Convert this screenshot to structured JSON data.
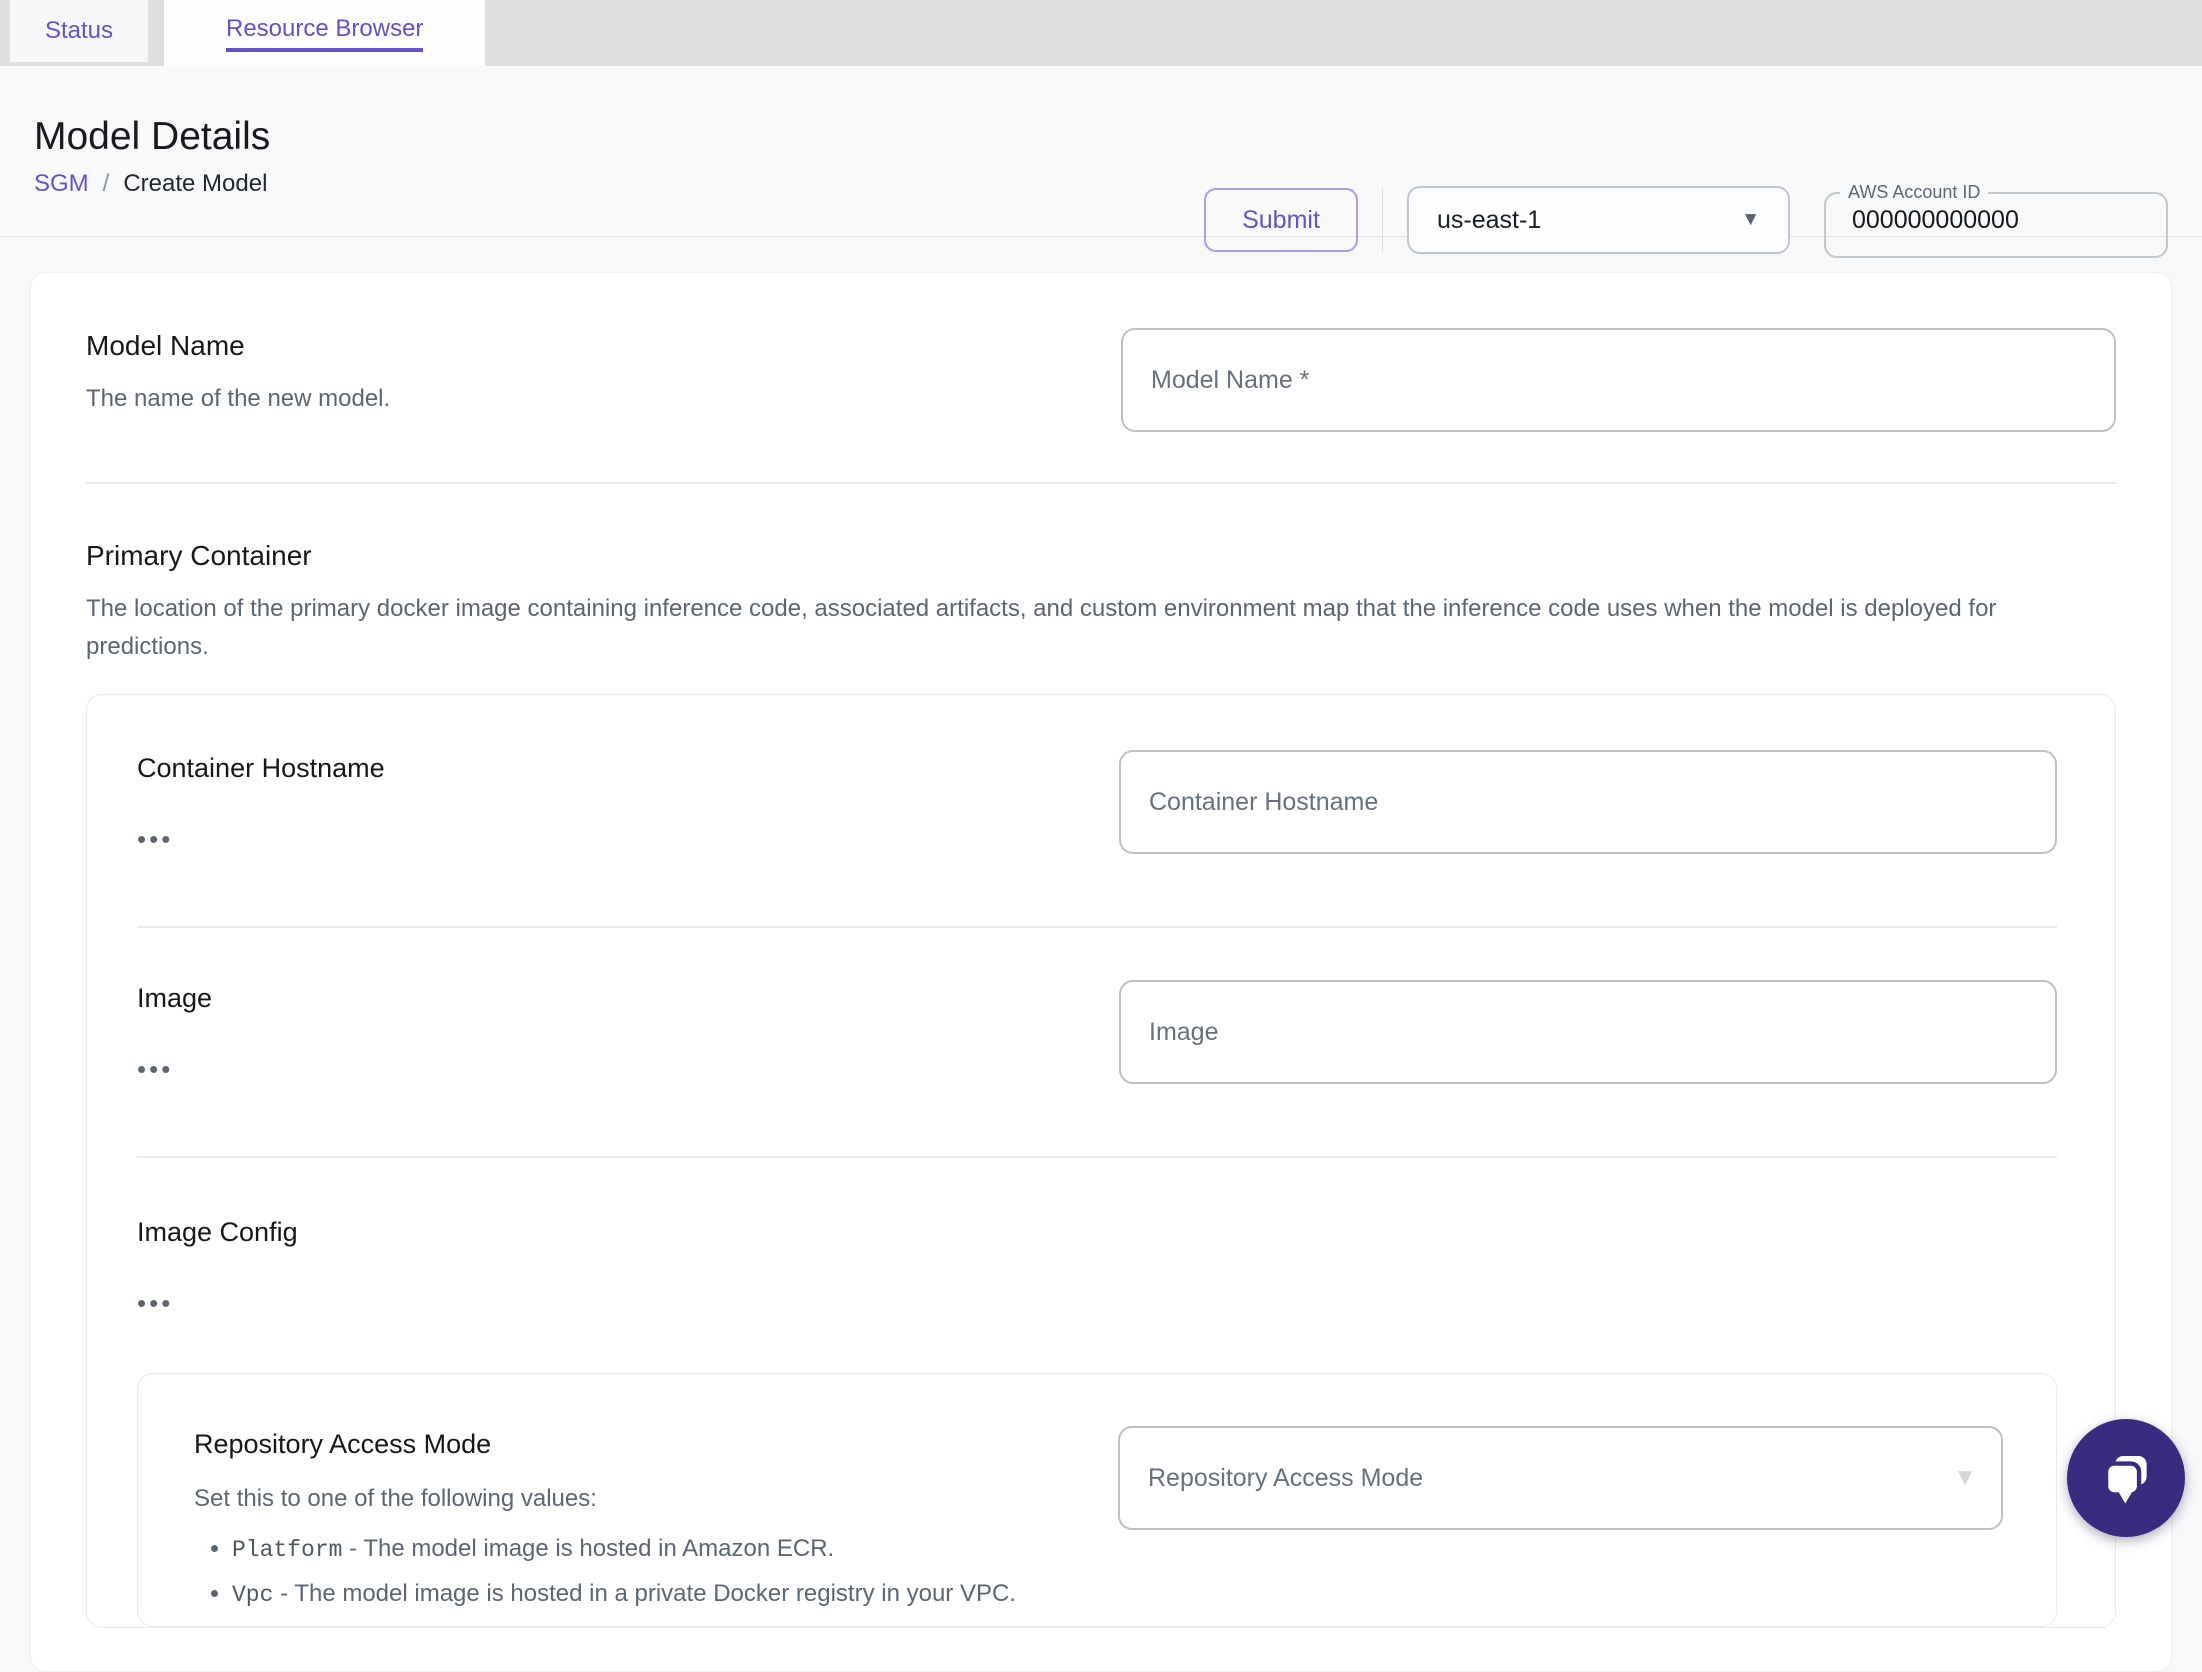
{
  "tabs": [
    {
      "label": "Status",
      "active": false
    },
    {
      "label": "Resource Browser",
      "active": true
    }
  ],
  "header": {
    "title": "Model Details",
    "breadcrumb": {
      "parent": "SGM",
      "separator": "/",
      "current": "Create Model"
    },
    "submit_label": "Submit",
    "region": {
      "value": "us-east-1",
      "arrow_icon": "▼"
    },
    "account": {
      "label": "AWS Account ID",
      "value": "000000000000"
    }
  },
  "form": {
    "model_name": {
      "title": "Model Name",
      "description": "The name of the new model.",
      "placeholder": "Model Name *"
    },
    "primary_container": {
      "title": "Primary Container",
      "description": "The location of the primary docker image containing inference code, associated artifacts, and custom environment map that the inference code uses when the model is deployed for predictions.",
      "container_hostname": {
        "title": "Container Hostname",
        "expander": "•••",
        "placeholder": "Container Hostname"
      },
      "image": {
        "title": "Image",
        "expander": "•••",
        "placeholder": "Image"
      },
      "image_config": {
        "title": "Image Config",
        "expander": "•••",
        "repository_access_mode": {
          "title": "Repository Access Mode",
          "description": "Set this to one of the following values:",
          "options": [
            {
              "code": "Platform",
              "text": "- The model image is hosted in Amazon ECR."
            },
            {
              "code": "Vpc",
              "text": "- The model image is hosted in a private Docker registry in your VPC."
            }
          ],
          "placeholder": "Repository Access Mode",
          "arrow_icon": "▼"
        }
      }
    }
  },
  "chat": {
    "icon": "chat-bubbles-icon"
  },
  "colors": {
    "accent_purple": "#6254c7",
    "chat_purple": "#3b2b80",
    "tabbar_bg": "#dcdee0",
    "header_bg": "#f8f9fa",
    "page_bg": "#f7f8fa",
    "input_border": "#bcc1c6",
    "divider": "#e8eaec",
    "text_primary": "#16191c",
    "text_secondary": "#5b6672"
  }
}
